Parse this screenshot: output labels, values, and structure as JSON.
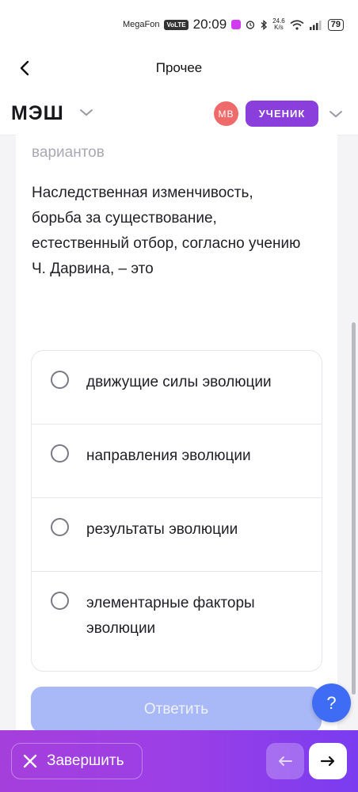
{
  "status_bar": {
    "carrier": "MegaFon",
    "volte": "VoLTE",
    "time": "20:09",
    "net_speed_value": "24.6",
    "net_speed_unit": "K/s",
    "battery": "79"
  },
  "nav": {
    "title": "Прочее"
  },
  "header": {
    "logo": "МЭШ",
    "avatar_initials": "МВ",
    "role": "УЧЕНИК"
  },
  "question": {
    "partial_hint": "вариантов",
    "text": "Наследственная изменчивость, борьба за существование, естественный отбор, согласно учению Ч. Дарвина, – это",
    "options": [
      {
        "label": "движущие силы эволюции"
      },
      {
        "label": "направления эволюции"
      },
      {
        "label": "результаты эволюции"
      },
      {
        "label": "элементарные факторы эволюции"
      }
    ],
    "submit_label": "Ответить"
  },
  "help": {
    "label": "?"
  },
  "bottom": {
    "finish_label": "Завершить"
  },
  "colors": {
    "accent": "#8a3fdc",
    "submit_disabled": "#a9b9f7",
    "help": "#3e6cf4",
    "avatar": "#ef6b6b"
  }
}
